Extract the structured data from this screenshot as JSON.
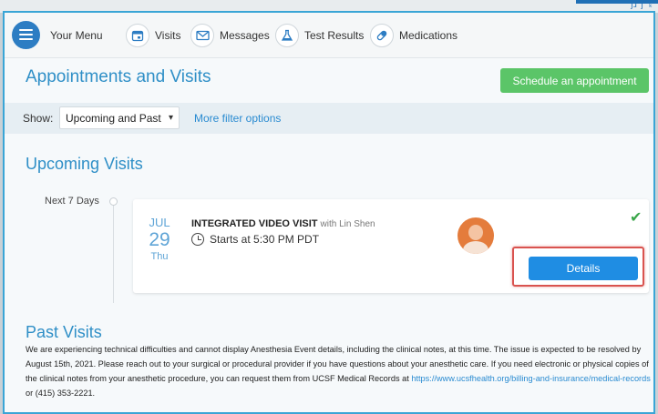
{
  "nav": {
    "menu_label": "Your Menu",
    "items": [
      {
        "label": "Visits",
        "icon": "calendar-icon"
      },
      {
        "label": "Messages",
        "icon": "envelope-icon"
      },
      {
        "label": "Test Results",
        "icon": "flask-icon"
      },
      {
        "label": "Medications",
        "icon": "pill-icon"
      }
    ]
  },
  "header": {
    "title": "Appointments and Visits",
    "schedule_button": "Schedule an appointment"
  },
  "filter": {
    "show_label": "Show:",
    "selected": "Upcoming and Past",
    "more_link": "More filter options"
  },
  "upcoming": {
    "title": "Upcoming Visits",
    "timeline_label": "Next 7 Days",
    "visit": {
      "month": "JUL",
      "day": "29",
      "weekday": "Thu",
      "type": "INTEGRATED VIDEO VISIT",
      "with": "with Lin Shen",
      "time": "Starts at 5:30 PM PDT",
      "details_button": "Details"
    }
  },
  "past": {
    "title": "Past Visits",
    "notice": "We are experiencing technical difficulties and cannot display Anesthesia Event details, including the clinical notes, at this time. The issue is expected to be resolved by August 15th, 2021. Please reach out to your surgical or procedural provider if you have questions about your anesthetic care. If you need electronic or physical copies of the clinical notes from your anesthetic procedure, you can request them from UCSF Medical Records at",
    "link": "https://www.ucsfhealth.org/billing-and-insurance/medical-records",
    "or_phone": " or (415) 353-2221."
  },
  "colors": {
    "accent": "#2f8fc7",
    "schedule_green": "#5bc568",
    "details_blue": "#1f8de3",
    "highlight_red": "#d9534f"
  }
}
